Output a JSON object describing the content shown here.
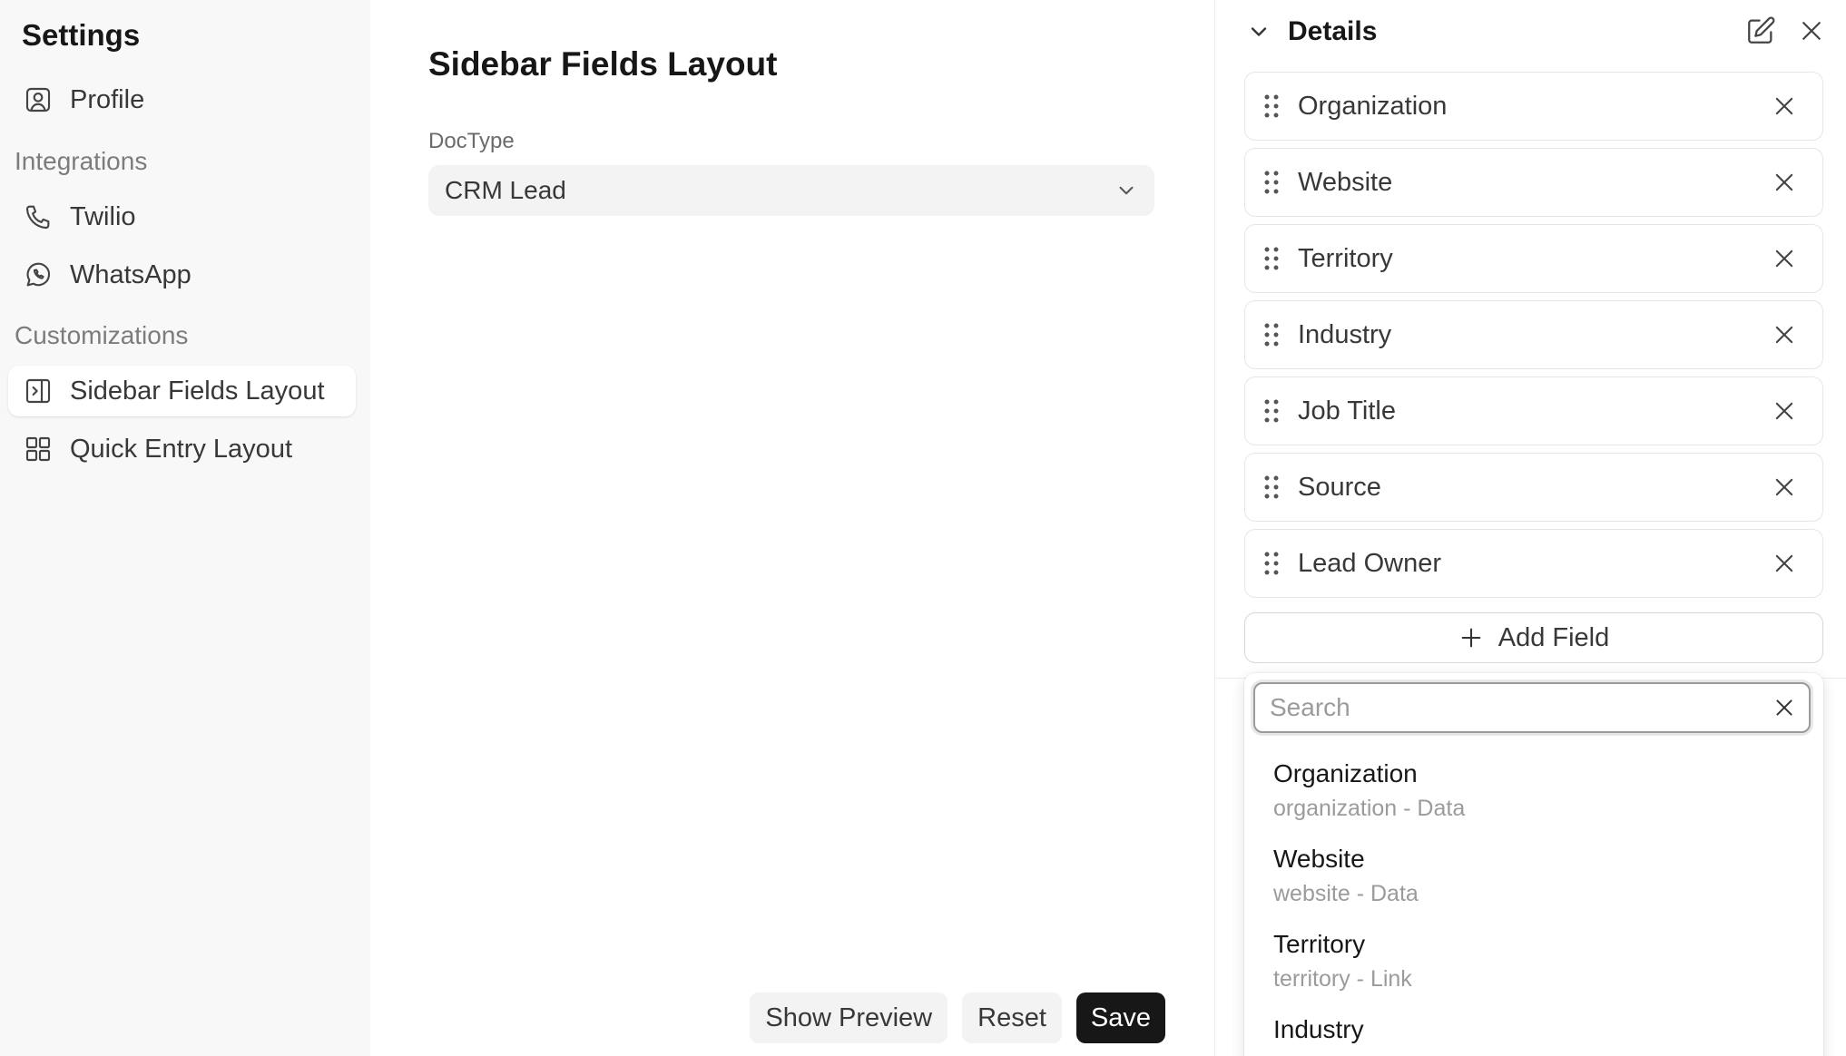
{
  "sidebar": {
    "title": "Settings",
    "items": [
      {
        "label": "Profile",
        "icon": "user-square-icon"
      },
      {
        "label": "Twilio",
        "icon": "phone-icon"
      },
      {
        "label": "WhatsApp",
        "icon": "whatsapp-icon"
      },
      {
        "label": "Sidebar Fields Layout",
        "icon": "sidebar-layout-icon",
        "active": true
      },
      {
        "label": "Quick Entry Layout",
        "icon": "grid-icon"
      }
    ],
    "sections": {
      "integrations": "Integrations",
      "customizations": "Customizations"
    }
  },
  "main": {
    "title": "Sidebar Fields Layout",
    "doctype_label": "DocType",
    "doctype_value": "CRM Lead",
    "buttons": {
      "preview": "Show Preview",
      "reset": "Reset",
      "save": "Save"
    }
  },
  "panel": {
    "title": "Details",
    "fields": [
      "Organization",
      "Website",
      "Territory",
      "Industry",
      "Job Title",
      "Source",
      "Lead Owner"
    ],
    "add_field_label": "Add Field",
    "search": {
      "placeholder": "Search",
      "value": ""
    },
    "options": [
      {
        "label": "Organization",
        "meta": "organization - Data"
      },
      {
        "label": "Website",
        "meta": "website - Data"
      },
      {
        "label": "Territory",
        "meta": "territory - Link"
      },
      {
        "label": "Industry",
        "meta": ""
      }
    ]
  },
  "colors": {
    "sidebar_bg": "#f8f8f8",
    "primary_button": "#171717",
    "subtle_button": "#f3f3f3",
    "muted_text": "#9b9b9b"
  }
}
